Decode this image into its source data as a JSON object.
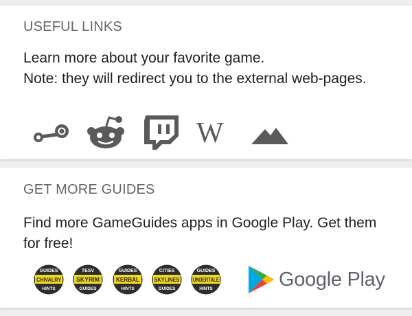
{
  "useful_links": {
    "title": "USEFUL LINKS",
    "text": "Learn more about your favorite game.",
    "note": "Note: they will redirect you to the external web-pages.",
    "icons": [
      "steam-icon",
      "reddit-icon",
      "twitch-icon",
      "wikipedia-icon",
      "mountain-icon"
    ],
    "wiki_glyph": "W"
  },
  "more_guides": {
    "title": "GET MORE GUIDES",
    "text": "Find more GameGuides apps in Google Play. Get them for free!",
    "apps": [
      {
        "top": "GUIDES",
        "name": "CHIVALRY",
        "bottom": "HINTS"
      },
      {
        "top": "TESV",
        "name": "SKYRIM",
        "bottom": "GUIDES"
      },
      {
        "top": "GUIDES",
        "name": "KERBAL",
        "bottom": "HINTS"
      },
      {
        "top": "CITIES",
        "name": "SKYLINES",
        "bottom": "GUIDES"
      },
      {
        "top": "GUIDES",
        "name": "UNDERTALE",
        "bottom": "HINTS"
      }
    ],
    "store_label": "Google Play"
  },
  "colors": {
    "badge_ring": "#2d2d2d",
    "badge_band": "#f2d81c",
    "icon_gray": "#5a5a5a"
  }
}
